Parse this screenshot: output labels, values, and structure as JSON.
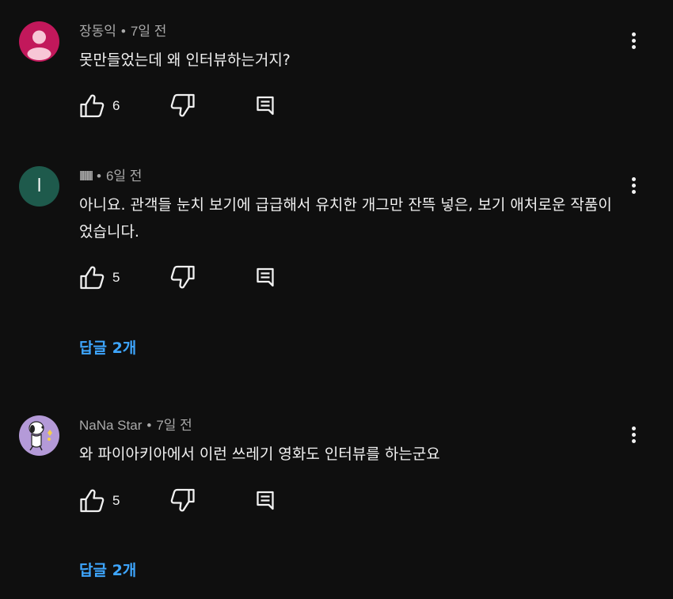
{
  "colors": {
    "background": "#0f0f0f",
    "text": "#f1f1f1",
    "meta": "#aaaaaa",
    "link": "#3ea6ff"
  },
  "comments": [
    {
      "author": "장동익",
      "time": "7일 전",
      "text": "못만들었는데 왜 인터뷰하는거지?",
      "likes": "6",
      "avatar": {
        "type": "default-person",
        "color": "#c2185b"
      }
    },
    {
      "author": "lllllllll",
      "time": "6일 전",
      "text": "아니요. 관객들 눈치 보기에 급급해서 유치한 개그만 잔뜩 넣은, 보기 애처로운 작품이었습니다.",
      "likes": "5",
      "replies": "답글 2개",
      "avatar": {
        "type": "letter",
        "letter": "l",
        "color": "#1e5a4c"
      }
    },
    {
      "author": "NaNa Star",
      "time": "7일 전",
      "text": "와 파이아키아에서 이런 쓰레기 영화도 인터뷰를 하는군요",
      "likes": "5",
      "replies": "답글 2개",
      "avatar": {
        "type": "image",
        "color": "#b49ad8"
      }
    }
  ],
  "icons": {
    "like": "thumb-up-icon",
    "dislike": "thumb-down-icon",
    "reply": "comment-icon",
    "more": "more-vertical-icon"
  }
}
